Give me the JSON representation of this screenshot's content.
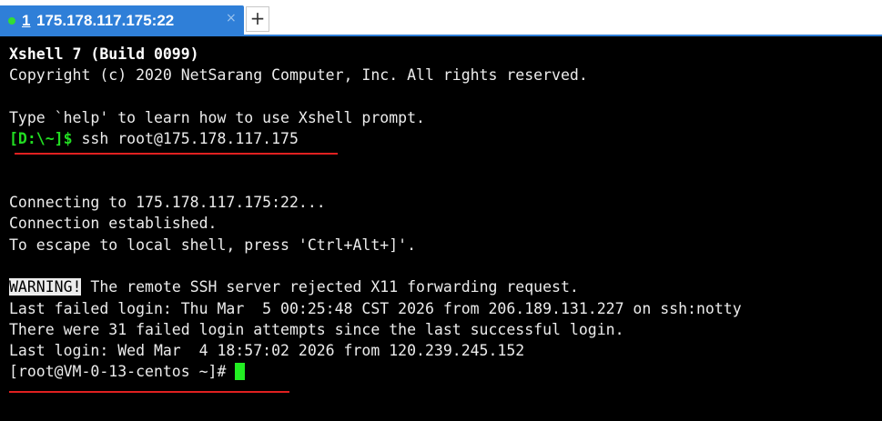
{
  "tab": {
    "number": "1",
    "title": " 175.178.117.175:22",
    "close": "×",
    "new_tab": "+"
  },
  "terminal": {
    "line1": "Xshell 7 (Build 0099)",
    "line2": "Copyright (c) 2020 NetSarang Computer, Inc. All rights reserved.",
    "line4": "Type `help' to learn how to use Xshell prompt.",
    "local_prompt": "[D:\\~]$",
    "local_command": " ssh root@175.178.117.175",
    "line8": "Connecting to 175.178.117.175:22...",
    "line9": "Connection established.",
    "line10": "To escape to local shell, press 'Ctrl+Alt+]'.",
    "warning_label": "WARNING!",
    "warning_text": " The remote SSH server rejected X11 forwarding request.",
    "line13": "Last failed login: Thu Mar  5 00:25:48 CST 2026 from 206.189.131.227 on ssh:notty",
    "line14": "There were 31 failed login attempts since the last successful login.",
    "line15": "Last login: Wed Mar  4 18:57:02 2026 from 120.239.245.152",
    "remote_prompt": "[root@VM-0-13-centos ~]# "
  },
  "colors": {
    "tab_active": "#2f7fd8",
    "prompt_green": "#22dd22",
    "annotation_red": "#e02020"
  }
}
